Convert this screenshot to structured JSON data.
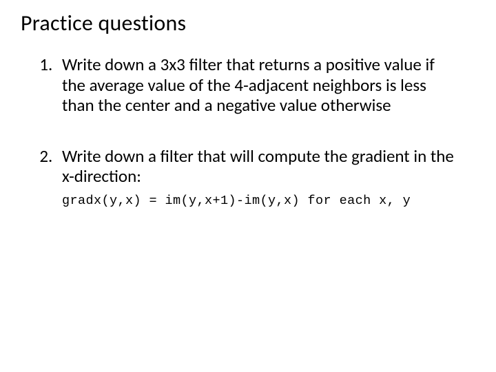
{
  "title": "Practice questions",
  "questions": [
    {
      "body": "Write down a 3x3 filter that returns a positive value if the average value of the 4-adjacent neighbors is less than the center and a negative value otherwise"
    },
    {
      "body": "Write down a filter that will compute the gradient in the x-direction:",
      "code": "gradx(y,x) = im(y,x+1)-im(y,x) for each x, y"
    }
  ]
}
